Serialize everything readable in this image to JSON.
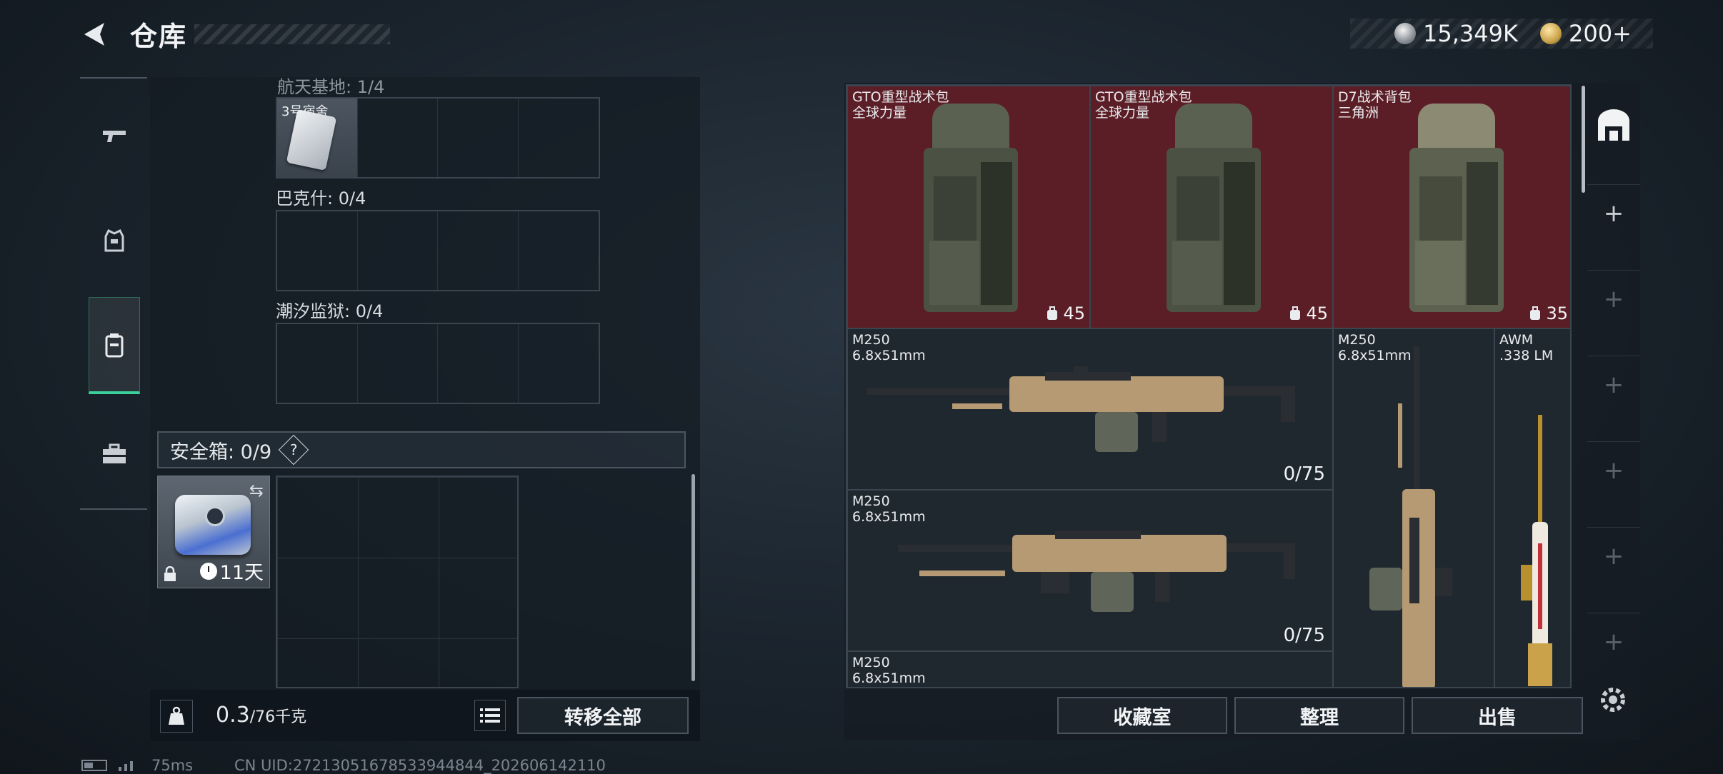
{
  "header": {
    "title": "仓库",
    "currency": [
      {
        "icon": "silver-coin-icon",
        "amount": "15,349K"
      },
      {
        "icon": "gold-coin-icon",
        "amount": "200+"
      }
    ]
  },
  "left_nav": [
    {
      "name": "weapons",
      "icon": "gun-icon",
      "active": false
    },
    {
      "name": "armor",
      "icon": "armor-vest-icon",
      "active": false
    },
    {
      "name": "backpack",
      "icon": "backpack-icon",
      "active": true
    },
    {
      "name": "keys",
      "icon": "toolbox-icon",
      "active": false
    }
  ],
  "storage": {
    "top_cut_label": "航天基地: 1/4",
    "key_item_label": "3号宿舍",
    "sections": [
      {
        "label": "巴克什: 0/4"
      },
      {
        "label": "潮汐监狱: 0/4"
      }
    ],
    "safe_box": {
      "label": "安全箱: 0/9",
      "help": "?",
      "timer": "11天"
    },
    "weight": {
      "value": "0.3",
      "max": "/76千克"
    },
    "transfer_all": "转移全部"
  },
  "inventory": {
    "items": [
      {
        "name": "GTO重型战术包",
        "sub": "全球力量",
        "capacity": "45"
      },
      {
        "name": "GTO重型战术包",
        "sub": "全球力量",
        "capacity": "45"
      },
      {
        "name": "D7战术背包",
        "sub": "三角洲",
        "capacity": "35"
      },
      {
        "name": "M250",
        "sub": "6.8x51mm",
        "ammo": "0/75"
      },
      {
        "name": "M250",
        "sub": "6.8x51mm",
        "ammo": ""
      },
      {
        "name": "AWM",
        "sub": ".338 LM",
        "ammo": ""
      },
      {
        "name": "M250",
        "sub": "6.8x51mm",
        "ammo": "0/75"
      },
      {
        "name": "M250",
        "sub": "6.8x51mm",
        "ammo": ""
      }
    ],
    "buttons": {
      "collection": "收藏室",
      "sort": "整理",
      "sell": "出售"
    }
  },
  "side_tabs": [
    "+",
    "+",
    "+",
    "+",
    "+",
    "+"
  ],
  "footer": {
    "ping": "75ms",
    "uid": "CN UID:27213051678533944844_202606142110"
  },
  "colors": {
    "accent": "#3bd19a",
    "item_red": "#5b1e26"
  }
}
